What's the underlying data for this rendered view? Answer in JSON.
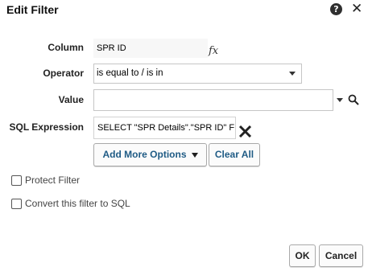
{
  "dialog": {
    "title": "Edit Filter",
    "help_icon": "question-circle-icon",
    "close_icon": "close-icon",
    "help_glyph": "?",
    "close_glyph": "✕"
  },
  "form": {
    "column_label": "Column",
    "column_value": "SPR ID",
    "fx_glyph": "fx",
    "operator_label": "Operator",
    "operator_value": "is equal to / is in",
    "value_label": "Value",
    "value_input": "",
    "sql_label": "SQL Expression",
    "sql_value": "SELECT \"SPR Details\".\"SPR ID\" FR",
    "add_more_options": "Add More Options",
    "clear_all": "Clear All"
  },
  "options": {
    "protect_filter": "Protect Filter",
    "protect_filter_checked": false,
    "convert_to_sql": "Convert this filter to SQL",
    "convert_to_sql_checked": false
  },
  "footer": {
    "ok": "OK",
    "cancel": "Cancel"
  },
  "colors": {
    "button_text": "#1f5b85",
    "border": "#c6c6c6"
  }
}
